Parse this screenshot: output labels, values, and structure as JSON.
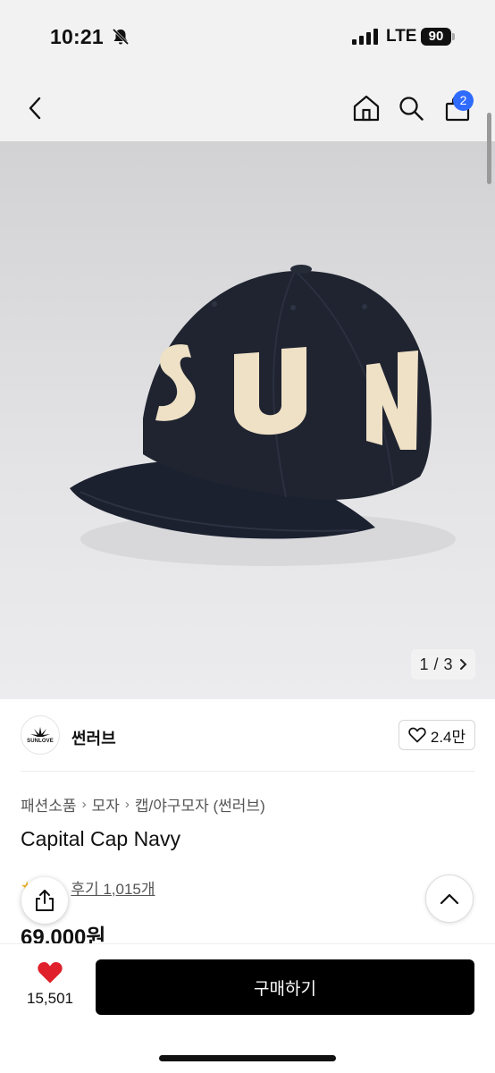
{
  "status_bar": {
    "time": "10:21",
    "network": "LTE",
    "battery": "90"
  },
  "nav": {
    "cart_count": "2"
  },
  "gallery": {
    "current": "1",
    "separator": "/",
    "total": "3",
    "cap_lettering": [
      "S",
      "U",
      "N"
    ]
  },
  "brand": {
    "name": "썬러브",
    "logo_text": "SUNLOVE",
    "likes": "2.4만"
  },
  "breadcrumb": [
    "패션소품",
    "모자",
    "캡/야구모자 (썬러브)"
  ],
  "product": {
    "title": "Capital Cap Navy",
    "review_label": "후기 1,015개",
    "price": "69,000원"
  },
  "bottom_bar": {
    "wish_count": "15,501",
    "buy_label": "구매하기"
  },
  "colors": {
    "accent_badge": "#2f6bff",
    "heart": "#e0202a",
    "cap_navy": "#1f2430",
    "cap_letter": "#efe1c6"
  }
}
